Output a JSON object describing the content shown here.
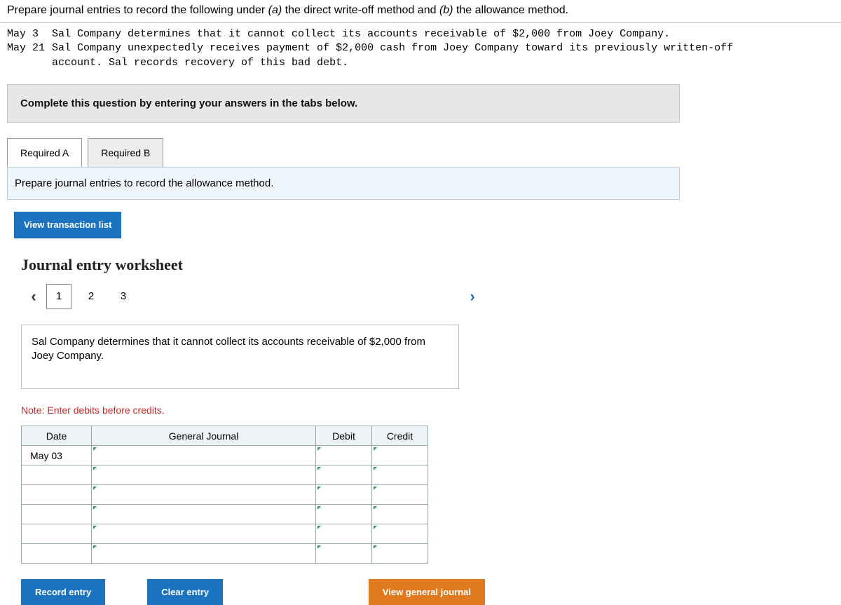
{
  "intro": {
    "prefix": "Prepare journal entries to record the following under ",
    "part_a_label": "(a)",
    "part_a_text": " the direct write-off method and ",
    "part_b_label": "(b)",
    "part_b_text": " the allowance method."
  },
  "events": [
    {
      "label": "May  3",
      "text": "Sal Company determines that it cannot collect its accounts receivable of $2,000 from Joey Company."
    },
    {
      "label": "May 21",
      "text": "Sal Company unexpectedly receives payment of $2,000 cash from Joey Company toward its previously written-off"
    },
    {
      "label": "      ",
      "text": "account. Sal records recovery of this bad debt."
    }
  ],
  "complete_bar": "Complete this question by entering your answers in the tabs below.",
  "tabs": {
    "a": "Required A",
    "b": "Required B",
    "active": "b",
    "b_text": "Prepare journal entries to record the allowance method."
  },
  "buttons": {
    "view_trans": "View transaction list",
    "record": "Record entry",
    "clear": "Clear entry",
    "view_journal": "View general journal"
  },
  "worksheet": {
    "title": "Journal entry worksheet",
    "steps": [
      "1",
      "2",
      "3"
    ],
    "active_step": "1",
    "description": "Sal Company determines that it cannot collect its accounts receivable of $2,000 from Joey Company.",
    "note": "Note: Enter debits before credits.",
    "headers": {
      "date": "Date",
      "gj": "General Journal",
      "debit": "Debit",
      "credit": "Credit"
    },
    "rows": [
      {
        "date": "May 03"
      },
      {
        "date": ""
      },
      {
        "date": ""
      },
      {
        "date": ""
      },
      {
        "date": ""
      },
      {
        "date": ""
      }
    ]
  }
}
